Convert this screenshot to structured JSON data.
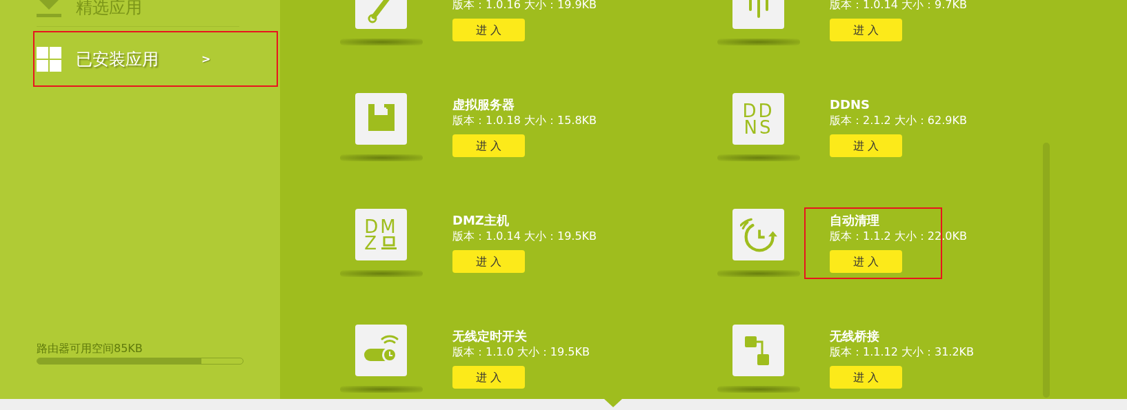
{
  "sidebar": {
    "items": [
      {
        "label": "精选应用",
        "kind": "download",
        "selected": false,
        "highlighted": false
      },
      {
        "label": "已安装应用",
        "kind": "grid",
        "selected": true,
        "highlighted": true,
        "arrow": ">"
      }
    ],
    "storage": {
      "label": "路由器可用空间85KB",
      "level": 0.8
    }
  },
  "apps": [
    {
      "kind": "wrench",
      "version_size": "版本：1.0.16 大小：19.9KB",
      "button": "进 入",
      "highlighted": false
    },
    {
      "kind": "lines",
      "version_size": "版本：1.0.14 大小：9.7KB",
      "button": "进 入",
      "highlighted": false
    },
    {
      "kind": "floppy",
      "title": "虚拟服务器",
      "version_size": "版本：1.0.18 大小：15.8KB",
      "button": "进 入",
      "highlighted": false
    },
    {
      "kind": "letters",
      "icon_text": [
        "DD",
        "NS"
      ],
      "title": "DDNS",
      "version_size": "版本：2.1.2 大小：62.9KB",
      "button": "进 入",
      "highlighted": false
    },
    {
      "kind": "dmz",
      "icon_text": [
        "DM",
        "Z"
      ],
      "title": "DMZ主机",
      "version_size": "版本：1.0.14 大小：19.5KB",
      "button": "进 入",
      "highlighted": false
    },
    {
      "kind": "clock-refresh",
      "title": "自动清理",
      "version_size": "版本：1.1.2 大小：22.0KB",
      "button": "进 入",
      "highlighted": true
    },
    {
      "kind": "toggle-clock",
      "title": "无线定时开关",
      "version_size": "版本：1.1.0 大小：19.5KB",
      "button": "进 入",
      "highlighted": false
    },
    {
      "kind": "squares",
      "title": "无线桥接",
      "version_size": "版本：1.1.12 大小：31.2KB",
      "button": "进 入",
      "highlighted": false
    }
  ]
}
